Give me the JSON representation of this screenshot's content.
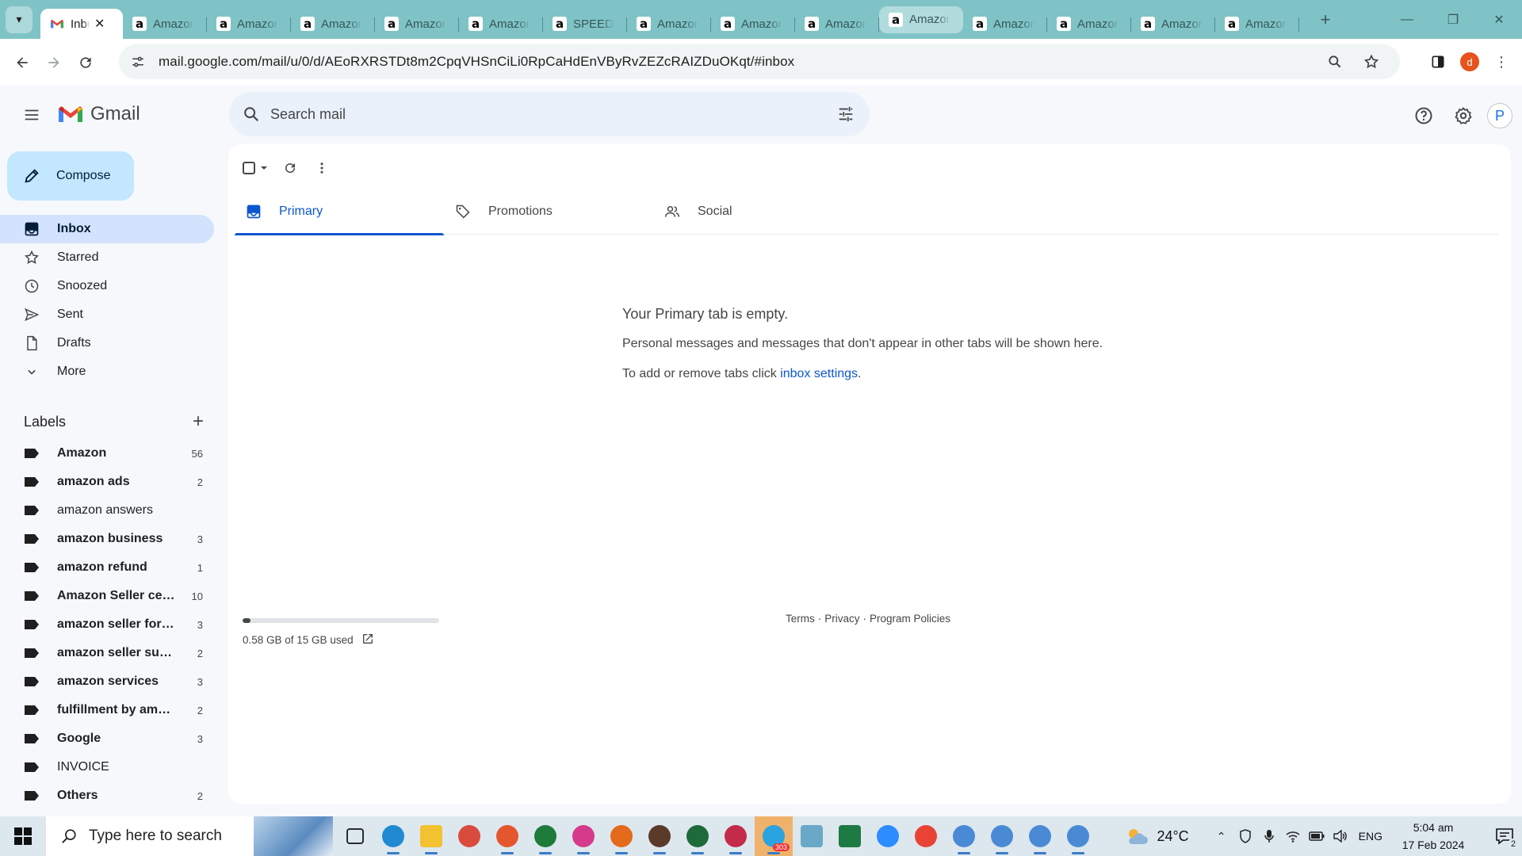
{
  "browser": {
    "tabs": [
      {
        "title": "Inbox",
        "favicon": "gmail",
        "active": true
      },
      {
        "title": "Amazon",
        "favicon": "a"
      },
      {
        "title": "Amazon",
        "favicon": "a"
      },
      {
        "title": "Amazon",
        "favicon": "a"
      },
      {
        "title": "Amazon",
        "favicon": "a"
      },
      {
        "title": "Amazon",
        "favicon": "a"
      },
      {
        "title": "SPEED",
        "favicon": "a"
      },
      {
        "title": "Amazon",
        "favicon": "a"
      },
      {
        "title": "Amazon",
        "favicon": "a"
      },
      {
        "title": "Amazon",
        "favicon": "a"
      },
      {
        "title": "Amazon",
        "favicon": "a",
        "hover": true
      },
      {
        "title": "Amazon",
        "favicon": "a"
      },
      {
        "title": "Amazon",
        "favicon": "a"
      },
      {
        "title": "Amazon",
        "favicon": "a"
      },
      {
        "title": "Amazon",
        "favicon": "a"
      }
    ],
    "url": "mail.google.com/mail/u/0/d/AEoRXRSTDt8m2CpqVHSnCiLi0RpCaHdEnVByRvZEZcRAIZDuOKqt/#inbox",
    "profile_initial": "d"
  },
  "gmail": {
    "app_name": "Gmail",
    "search_placeholder": "Search mail",
    "account_initial": "P",
    "compose_label": "Compose",
    "nav": [
      {
        "label": "Inbox",
        "icon": "inbox-icon",
        "active": true
      },
      {
        "label": "Starred",
        "icon": "star-icon"
      },
      {
        "label": "Snoozed",
        "icon": "clock-icon"
      },
      {
        "label": "Sent",
        "icon": "send-icon"
      },
      {
        "label": "Drafts",
        "icon": "draft-icon"
      },
      {
        "label": "More",
        "icon": "chevron-down-icon"
      }
    ],
    "labels_title": "Labels",
    "labels": [
      {
        "name": "Amazon",
        "count": "56",
        "bold": true
      },
      {
        "name": "amazon ads",
        "count": "2",
        "bold": true
      },
      {
        "name": "amazon answers",
        "count": "",
        "bold": false
      },
      {
        "name": "amazon business",
        "count": "3",
        "bold": true
      },
      {
        "name": "amazon refund",
        "count": "1",
        "bold": true
      },
      {
        "name": "Amazon Seller central",
        "count": "10",
        "bold": true
      },
      {
        "name": "amazon seller forums",
        "count": "3",
        "bold": true
      },
      {
        "name": "amazon seller support",
        "count": "2",
        "bold": true
      },
      {
        "name": "amazon services",
        "count": "3",
        "bold": true
      },
      {
        "name": "fulfillment by amazon",
        "count": "2",
        "bold": true
      },
      {
        "name": "Google",
        "count": "3",
        "bold": true
      },
      {
        "name": "INVOICE",
        "count": "",
        "bold": false
      },
      {
        "name": "Others",
        "count": "2",
        "bold": true
      }
    ],
    "category_tabs": [
      {
        "label": "Primary",
        "icon": "inbox-icon",
        "active": true
      },
      {
        "label": "Promotions",
        "icon": "tag-icon"
      },
      {
        "label": "Social",
        "icon": "people-icon"
      }
    ],
    "empty": {
      "title": "Your Primary tab is empty.",
      "line1": "Personal messages and messages that don't appear in other tabs will be shown here.",
      "line2_prefix": "To add or remove tabs click ",
      "line2_link": "inbox settings",
      "line2_suffix": "."
    },
    "storage": {
      "text": "0.58 GB of 15 GB used",
      "fraction": 0.039
    },
    "footer": {
      "terms": "Terms",
      "privacy": "Privacy",
      "policies": "Program Policies",
      "sep": "·"
    }
  },
  "taskbar": {
    "search_placeholder": "Type here to search",
    "apps": [
      {
        "name": "task-view",
        "color": "#2b2b2b",
        "running": false
      },
      {
        "name": "edge",
        "color": "#1f8ad2",
        "running": true
      },
      {
        "name": "file-explorer",
        "color": "#f2c230",
        "running": true
      },
      {
        "name": "paint",
        "color": "#d94c3d",
        "running": false
      },
      {
        "name": "chrome-d",
        "color": "#e4572e",
        "running": true
      },
      {
        "name": "chrome-D",
        "color": "#1e7b3a",
        "running": true
      },
      {
        "name": "chrome-d2",
        "color": "#d63a8a",
        "running": true
      },
      {
        "name": "chrome-d3",
        "color": "#e46a1c",
        "running": true
      },
      {
        "name": "chrome-rc",
        "color": "#5b3a29",
        "running": true
      },
      {
        "name": "chrome-D2",
        "color": "#1e6a3a",
        "running": true
      },
      {
        "name": "chrome-a",
        "color": "#c42a4a",
        "running": true
      },
      {
        "name": "telegram",
        "color": "#2aa3e0",
        "running": true,
        "badge": "303",
        "highlight": true
      },
      {
        "name": "notepad",
        "color": "#6aa8c8",
        "running": false
      },
      {
        "name": "excel",
        "color": "#1d7a43",
        "running": false
      },
      {
        "name": "zoom",
        "color": "#2d8cff",
        "running": false
      },
      {
        "name": "chrome",
        "color": "#e84335",
        "running": false
      },
      {
        "name": "chrome-profile-1",
        "color": "#4a8ad4",
        "running": true
      },
      {
        "name": "chrome-profile-2",
        "color": "#4a8ad4",
        "running": true
      },
      {
        "name": "chrome-profile-3",
        "color": "#4a8ad4",
        "running": true
      },
      {
        "name": "chrome-profile-4",
        "color": "#4a8ad4",
        "running": true
      }
    ],
    "weather": "24°C",
    "language": "ENG",
    "time": "5:04 am",
    "date": "17 Feb 2024",
    "notification_count": "2"
  }
}
